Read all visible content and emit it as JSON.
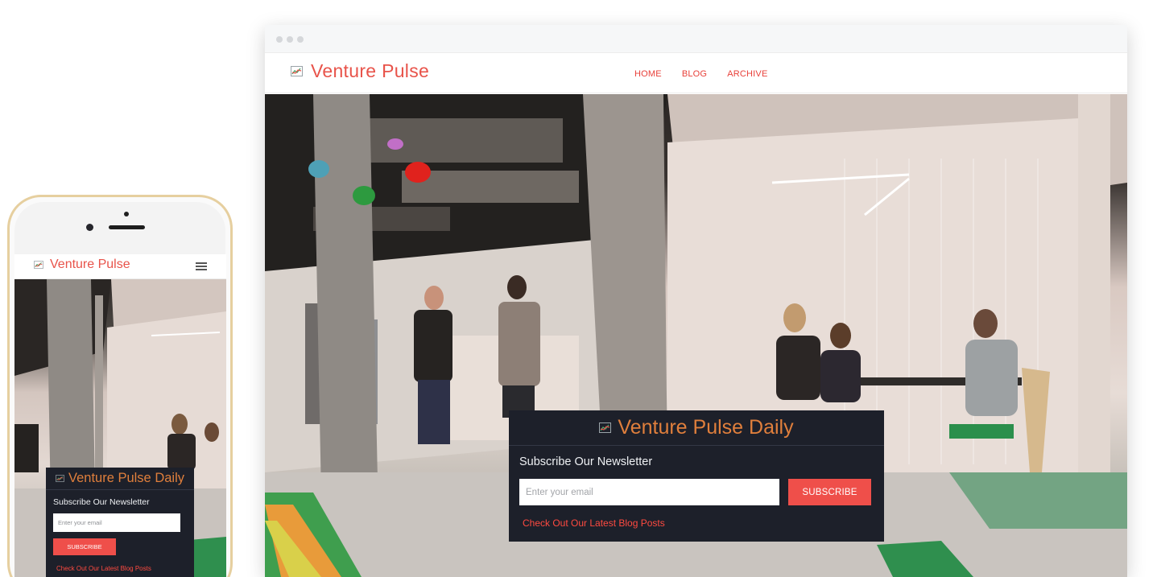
{
  "desktop": {
    "header": {
      "logo_text": "Venture Pulse",
      "logo_icon": "chart-icon",
      "nav": [
        {
          "label": "HOME"
        },
        {
          "label": "BLOG"
        },
        {
          "label": "ARCHIVE"
        }
      ]
    },
    "newsletter": {
      "title": "Venture Pulse Daily",
      "subtitle": "Subscribe Our Newsletter",
      "email_placeholder": "Enter your email",
      "button_label": "SUBSCRIBE",
      "link_text": "Check Out Our Latest Blog Posts"
    }
  },
  "mobile": {
    "header": {
      "logo_text": "Venture Pulse",
      "logo_icon": "chart-icon",
      "menu_icon": "hamburger-menu-icon"
    },
    "newsletter": {
      "title": "Venture Pulse Daily",
      "subtitle": "Subscribe Our Newsletter",
      "email_placeholder": "Enter your email",
      "button_label": "SUBSCRIBE",
      "link_text": "Check Out Our Latest Blog Posts"
    }
  },
  "colors": {
    "brand_red": "#e8534a",
    "panel_bg": "#1d202a",
    "title_orange": "#e07f3c",
    "button_red": "#ef4f4a",
    "phone_frame_gold": "#e6cf9f"
  }
}
